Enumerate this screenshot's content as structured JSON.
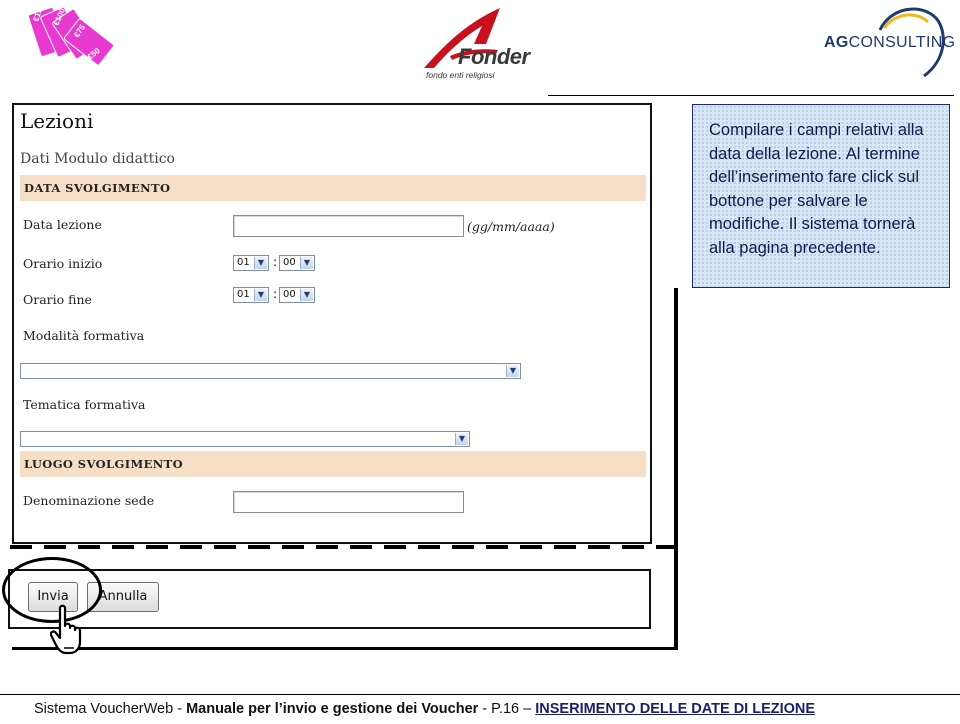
{
  "header": {
    "voucher_logo": {
      "icon": "voucher-cards-icon",
      "card_values": [
        "€150",
        "€100",
        "€75",
        "€50"
      ],
      "card_color": "#e83ad0"
    },
    "fonder_logo": {
      "wordmark": "Fonder",
      "tagline": "fondo enti religiosi",
      "accent_color": "#c8101e"
    },
    "agconsulting_logo": {
      "wordmark_a": "AG",
      "wordmark_b": "CONSULTING",
      "color": "#1f3b6e"
    }
  },
  "form": {
    "title": "Lezioni",
    "subtitle": "Dati Modulo didattico",
    "section_data": "DATA SVOLGIMENTO",
    "section_luogo": "LUOGO SVOLGIMENTO",
    "fields": {
      "data_lezione": {
        "label": "Data lezione",
        "value": "",
        "hint": "(gg/mm/aaaa)"
      },
      "orario_inizio": {
        "label": "Orario inizio",
        "hour": "01",
        "minute": "00",
        "separator": ":"
      },
      "orario_fine": {
        "label": "Orario fine",
        "hour": "01",
        "minute": "00",
        "separator": ":"
      },
      "modalita": {
        "label": "Modalità formativa",
        "selected": ""
      },
      "tematica": {
        "label": "Tematica formativa",
        "selected": ""
      },
      "sede": {
        "label": "Denominazione sede",
        "value": ""
      }
    },
    "band_color": "#f7dfc7"
  },
  "buttons": {
    "invia": "Invia",
    "annulla": "Annulla"
  },
  "callout": {
    "text": "Compilare i campi relativi alla data della lezione. Al termine dell’inserimento fare click sul bottone per salvare le modifiche. Il sistema tornerà alla pagina precedente.",
    "background": "#d9e6f5",
    "border_color": "#1b2a6b"
  },
  "footer": {
    "prefix": "Sistema VoucherWeb - ",
    "manual": "Manuale per l’invio e gestione dei Voucher",
    "page": " - P.16 – ",
    "section": "INSERIMENTO DELLE DATE DI LEZIONE"
  }
}
